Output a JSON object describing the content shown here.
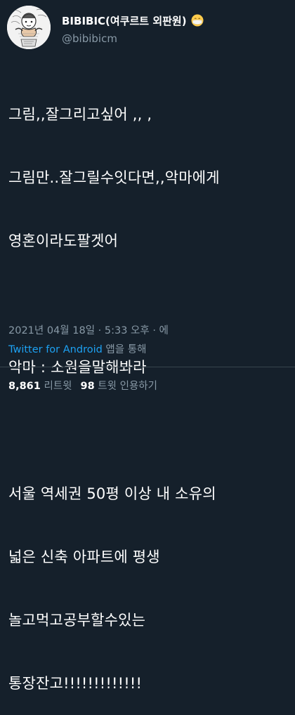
{
  "user": {
    "display_name": "BIBIBIC(여쿠르트 외판원)",
    "handle": "@bibibicm",
    "avatar": "cartoon-avatar",
    "badge_emoji": "face-with-medical-mask"
  },
  "tweet": {
    "lines": [
      "그림,,잘그리고싶어 ,, ,",
      "그림만..잘그릴수잇다면,,악마에게",
      "영혼이라도팔겟어",
      "",
      "악마 : 소원을말해봐라",
      "",
      "서울 역세권 50평 이상 내 소유의",
      "넓은 신축 아파트에 평생",
      "놀고먹고공부할수있는",
      "통장잔고!!!!!!!!!!!!!"
    ]
  },
  "meta": {
    "datetime": "2021년 04월 18일 · 5:33 오후 · 에",
    "source_link": "Twitter for Android",
    "source_suffix": " 앱을 통해"
  },
  "stats": {
    "retweets_count": "8,861",
    "retweets_label": " 리트윗",
    "quotes_count": "98",
    "quotes_label": " 트윗 인용하기"
  },
  "colors": {
    "background": "#15202b",
    "secondary_text": "#8899a6",
    "link": "#1da1f2",
    "divider": "#38444d"
  }
}
